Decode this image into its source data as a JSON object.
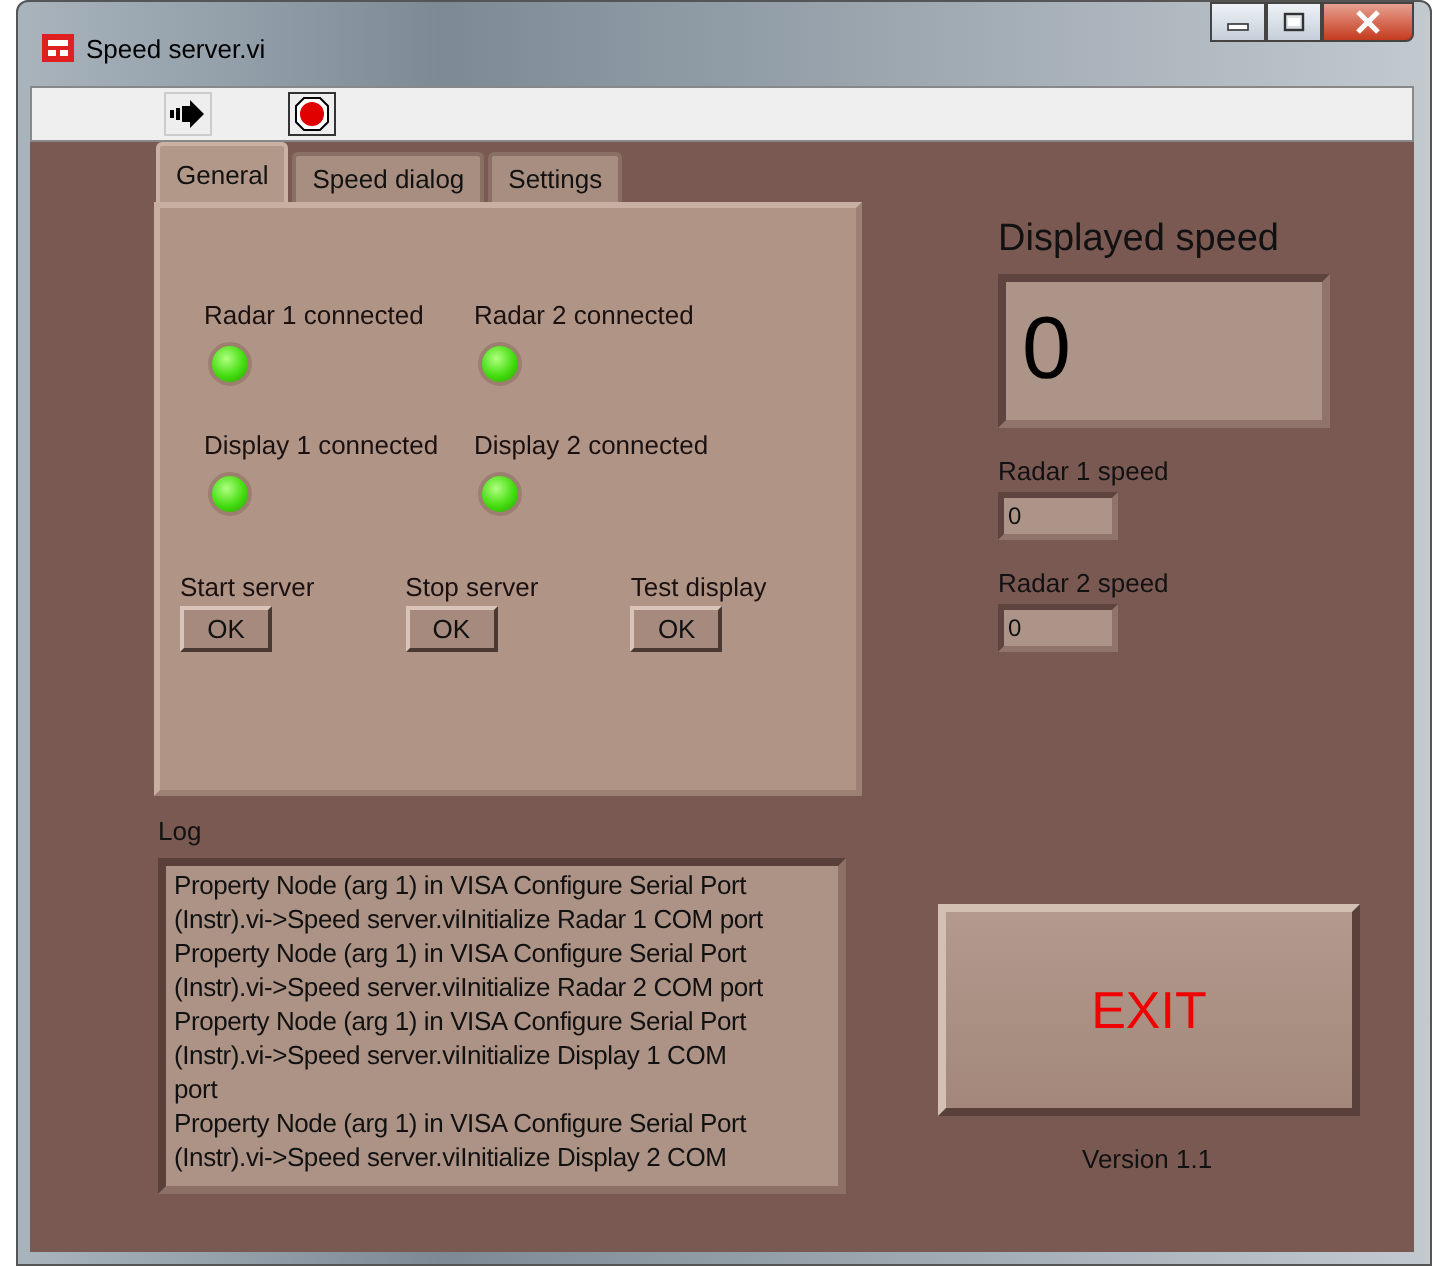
{
  "window": {
    "title": "Speed server.vi"
  },
  "tabs": [
    {
      "label": "General",
      "selected": true
    },
    {
      "label": "Speed dialog",
      "selected": false
    },
    {
      "label": "Settings",
      "selected": false
    }
  ],
  "indicators": [
    {
      "label": "Radar 1 connected",
      "on": true
    },
    {
      "label": "Radar 2 connected",
      "on": true
    },
    {
      "label": "Display 1 connected",
      "on": true
    },
    {
      "label": "Display 2 connected",
      "on": true
    }
  ],
  "buttons": [
    {
      "label": "Start server",
      "button": "OK"
    },
    {
      "label": "Stop server",
      "button": "OK"
    },
    {
      "label": "Test display",
      "button": "OK"
    }
  ],
  "log": {
    "label": "Log",
    "lines": [
      "Property Node (arg 1) in VISA Configure Serial Port",
      "(Instr).vi->Speed server.viInitialize Radar 1 COM port",
      "Property Node (arg 1) in VISA Configure Serial Port",
      "(Instr).vi->Speed server.viInitialize Radar 2 COM port",
      "Property Node (arg 1) in VISA Configure Serial Port",
      "(Instr).vi->Speed server.viInitialize Display 1 COM",
      "port",
      "Property Node (arg 1) in VISA Configure Serial Port",
      "(Instr).vi->Speed server.viInitialize Display 2 COM"
    ]
  },
  "displayed_speed": {
    "label": "Displayed speed",
    "value": "0"
  },
  "radar_speeds": [
    {
      "label": "Radar 1 speed",
      "value": "0"
    },
    {
      "label": "Radar 2 speed",
      "value": "0"
    }
  ],
  "exit_button": "EXIT",
  "version": "Version 1.1"
}
